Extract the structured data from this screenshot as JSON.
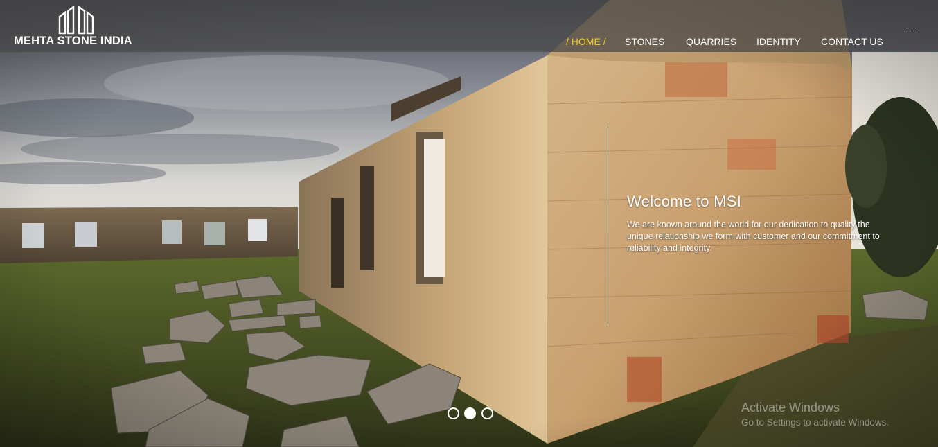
{
  "brand": {
    "name": "MEHTA STONE INDIA",
    "logo_icon": "building-columns-icon"
  },
  "nav": {
    "items": [
      {
        "label": "/ HOME /",
        "active": true
      },
      {
        "label": "STONES",
        "active": false
      },
      {
        "label": "QUARRIES",
        "active": false
      },
      {
        "label": "IDENTITY",
        "active": false
      },
      {
        "label": "CONTACT US",
        "active": false
      }
    ],
    "active_color": "#f2cc2a"
  },
  "hero": {
    "title": "Welcome to MSI",
    "text": "We are known around the world for our dedication to quality the unique relationship we form with customer and our commitment to reliability and integrity."
  },
  "slider": {
    "dot_count": 3,
    "active_index": 1
  },
  "watermark": {
    "title": "Activate Windows",
    "subtitle": "Go to Settings to activate Windows."
  }
}
